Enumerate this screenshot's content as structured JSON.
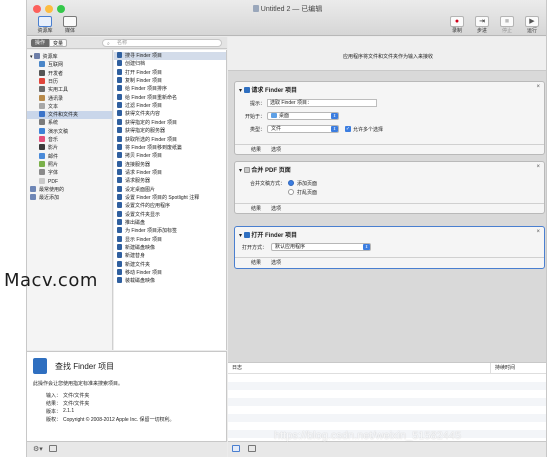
{
  "window": {
    "title": "Untitled 2 — 已编辑",
    "colors": {
      "close": "#fc605c",
      "minimize": "#fdbc40",
      "zoom": "#34c84a",
      "accent": "#3b7de0",
      "record": "#d0021b"
    }
  },
  "toolbar": {
    "left_items": [
      {
        "label": "资源库",
        "icon": "library-icon"
      },
      {
        "label": "媒体",
        "icon": "media-icon"
      }
    ],
    "right_items": [
      {
        "label": "录制",
        "icon": "record-icon",
        "glyph": "●"
      },
      {
        "label": "步进",
        "icon": "step-icon",
        "glyph": "⇥"
      },
      {
        "label": "停止",
        "icon": "stop-icon",
        "glyph": "■"
      },
      {
        "label": "运行",
        "icon": "run-icon",
        "glyph": "▶"
      }
    ]
  },
  "library_bar": {
    "tabs": [
      "操作",
      "变量"
    ],
    "search_placeholder": "名称"
  },
  "library": {
    "items": [
      {
        "label": "资源库",
        "icon": "library-folder-icon",
        "color": "#6e7fa8",
        "level": 0,
        "expanded": true
      },
      {
        "label": "互联网",
        "icon": "globe-icon",
        "color": "#4a86c8",
        "level": 1
      },
      {
        "label": "开发者",
        "icon": "developer-icon",
        "color": "#555555",
        "level": 1
      },
      {
        "label": "日历",
        "icon": "calendar-icon",
        "color": "#e0453b",
        "level": 1
      },
      {
        "label": "实用工具",
        "icon": "tools-icon",
        "color": "#6a6a6a",
        "level": 1
      },
      {
        "label": "通讯录",
        "icon": "contacts-icon",
        "color": "#b88a4a",
        "level": 1
      },
      {
        "label": "文本",
        "icon": "text-icon",
        "color": "#a7a7a7",
        "level": 1
      },
      {
        "label": "文件和文件夹",
        "icon": "finder-icon",
        "color": "#3a73c9",
        "level": 1,
        "selected": true
      },
      {
        "label": "系统",
        "icon": "system-icon",
        "color": "#7a7a7a",
        "level": 1
      },
      {
        "label": "演示文稿",
        "icon": "presentation-icon",
        "color": "#3e82d6",
        "level": 1
      },
      {
        "label": "音乐",
        "icon": "music-icon",
        "color": "#e5507a",
        "level": 1
      },
      {
        "label": "影片",
        "icon": "movie-icon",
        "color": "#3a3a3a",
        "level": 1
      },
      {
        "label": "邮件",
        "icon": "mail-icon",
        "color": "#4a8ad8",
        "level": 1
      },
      {
        "label": "照片",
        "icon": "photos-icon",
        "color": "#7ab04a",
        "level": 1
      },
      {
        "label": "字体",
        "icon": "fonts-icon",
        "color": "#8a8a8a",
        "level": 1
      },
      {
        "label": "PDF",
        "icon": "pdf-icon",
        "color": "#c9c9c9",
        "level": 1
      },
      {
        "label": "最常使用的",
        "icon": "smart-folder-icon",
        "color": "#6e86b6",
        "level": 0
      },
      {
        "label": "最近添加",
        "icon": "smart-folder-icon",
        "color": "#6e86b6",
        "level": 0
      }
    ]
  },
  "actions": {
    "items": [
      {
        "label": "搜寻 Finder 项目",
        "selected": true
      },
      {
        "label": "创建归档"
      },
      {
        "label": "打开 Finder 项目"
      },
      {
        "label": "复制 Finder 项目"
      },
      {
        "label": "给 Finder 项目排序"
      },
      {
        "label": "给 Finder 项目重新命名"
      },
      {
        "label": "过滤 Finder 项目"
      },
      {
        "label": "获得文件夹内容"
      },
      {
        "label": "获得指定的 Finder 项目"
      },
      {
        "label": "获得指定的服务器"
      },
      {
        "label": "获取所选的 Finder 项目"
      },
      {
        "label": "将 Finder 项目移到废纸篓"
      },
      {
        "label": "拷贝 Finder 项目"
      },
      {
        "label": "连接服务器"
      },
      {
        "label": "请求 Finder 项目"
      },
      {
        "label": "请求服务器"
      },
      {
        "label": "设定桌面图片"
      },
      {
        "label": "设置 Finder 项目的 Spotlight 注释"
      },
      {
        "label": "设置文件的应用程序"
      },
      {
        "label": "设置文件夹显示"
      },
      {
        "label": "推出磁盘"
      },
      {
        "label": "为 Finder 项目添加标签"
      },
      {
        "label": "显示 Finder 项目"
      },
      {
        "label": "新建磁盘映像"
      },
      {
        "label": "新建替身"
      },
      {
        "label": "新建文件夹"
      },
      {
        "label": "移动 Finder 项目"
      },
      {
        "label": "装载磁盘映像"
      }
    ]
  },
  "description": {
    "title": "查找 Finder 项目",
    "summary": "此操作会让您使用指定标准来搜索项目。",
    "rows": [
      {
        "key": "输入：",
        "value": "文件/文件夹"
      },
      {
        "key": "结果：",
        "value": "文件/文件夹"
      },
      {
        "key": "版本：",
        "value": "2.1.1"
      },
      {
        "key": "版权：",
        "value": "Copyright © 2008-2012 Apple Inc. 保留一切权利。"
      }
    ]
  },
  "workflow": {
    "header": "应用程序将文件和文件夹作为输入来接收",
    "cards": [
      {
        "title": "请求 Finder 项目",
        "fields": {
          "prompt_label": "提示：",
          "prompt_value": "选取 Finder 项目：",
          "start_label": "开始于：",
          "start_value": "桌面",
          "type_label": "类型：",
          "type_value": "文件",
          "multi_label": "允许多个选择",
          "multi_checked": true
        },
        "footer": [
          "结果",
          "选项"
        ]
      },
      {
        "title": "合并 PDF 页面",
        "fields": {
          "method_label": "合并文稿方式：",
          "option_append": "添加页面",
          "option_shuffle": "打乱页面",
          "selected": "添加页面"
        },
        "footer": [
          "结果",
          "选项"
        ]
      },
      {
        "title": "打开 Finder 项目",
        "fields": {
          "open_label": "打开方式：",
          "open_value": "默认应用程序"
        },
        "footer": [
          "结果",
          "选项"
        ]
      }
    ]
  },
  "log": {
    "col_log": "日志",
    "col_time": "持续时间"
  },
  "watermarks": {
    "left": "Macv.com",
    "right": "https://blog.csdn.net/weixin_51582445"
  }
}
